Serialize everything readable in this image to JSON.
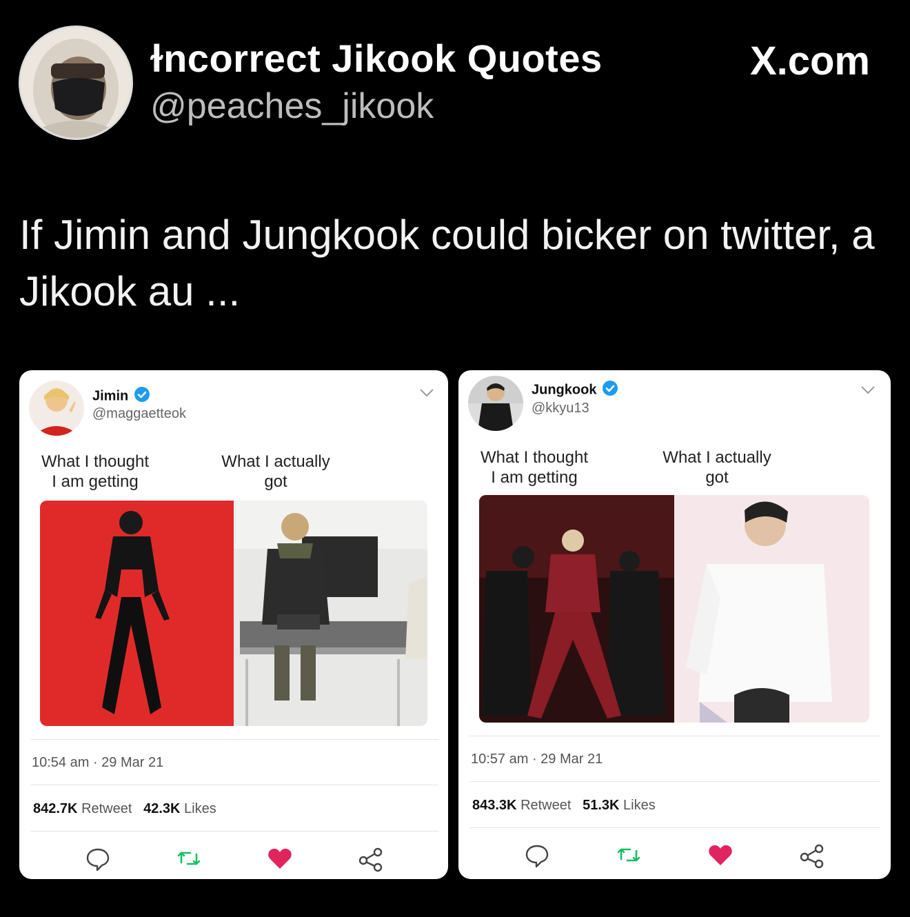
{
  "header": {
    "display_name": "ɫncorrect Jikook Quotes",
    "handle": "@peaches_jikook",
    "brand": "X.com"
  },
  "post_text": "If Jimin and Jungkook could bicker on twitter, a Jikook au ...",
  "cards": [
    {
      "name": "Jimin",
      "handle": "@maggaetteok",
      "caption_left": [
        "What I thought",
        "I am getting"
      ],
      "caption_right": [
        "What I actually",
        "got"
      ],
      "time": "10:54 am · 29 Mar 21",
      "retweets": "842.7K",
      "retweet_label": "Retweet",
      "likes": "42.3K",
      "likes_label": "Likes"
    },
    {
      "name": "Jungkook",
      "handle": "@kkyu13",
      "caption_left": [
        "What I thought",
        "I am getting"
      ],
      "caption_right": [
        "What I actually",
        "got"
      ],
      "time": "10:57 am · 29 Mar 21",
      "retweets": "843.3K",
      "retweet_label": "Retweet",
      "likes": "51.3K",
      "likes_label": "Likes"
    }
  ],
  "colors": {
    "verified": "#1d9bf0",
    "retweet_icon": "#17bf63",
    "heart": "#e0245e"
  }
}
